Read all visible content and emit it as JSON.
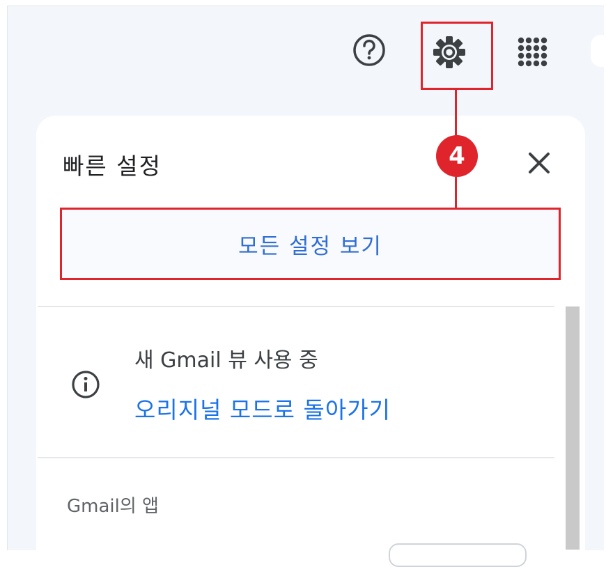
{
  "toolbar": {
    "help_icon": "help-circle-icon",
    "settings_icon": "gear-icon",
    "apps_icon": "apps-grid-icon"
  },
  "annotation": {
    "step_number": "4",
    "highlight_color": "#e0242b"
  },
  "quick_settings": {
    "title": "빠른 설정",
    "close_icon": "close-icon",
    "see_all_label": "모든 설정 보기",
    "notice": {
      "icon": "info-icon",
      "text": "새 Gmail 뷰 사용 중",
      "link": "오리지널 모드로 돌아가기"
    },
    "apps_section_title": "Gmail의 앱"
  },
  "colors": {
    "link": "#1a73e8",
    "button_text": "#2f6ed2",
    "background": "#f3f6fb"
  }
}
